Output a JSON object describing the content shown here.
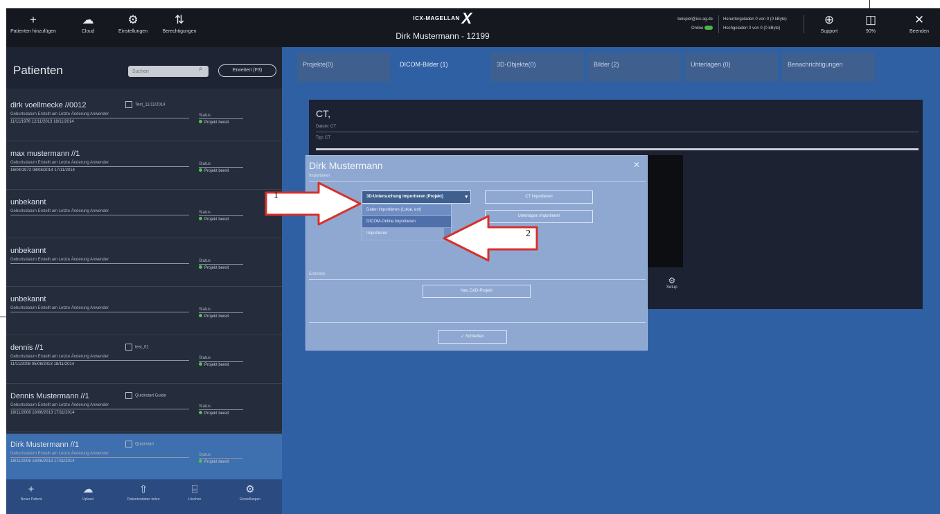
{
  "toolbar": {
    "items": [
      {
        "label": "Patienten hinzufügen",
        "icon": "plus-icon",
        "glyph": "+"
      },
      {
        "label": "Cloud",
        "icon": "cloud-icon",
        "glyph": "☁"
      },
      {
        "label": "Einstellungen",
        "icon": "gear-icon",
        "glyph": "⚙"
      },
      {
        "label": "Berechtigungen",
        "icon": "sort-icon",
        "glyph": "⇅"
      }
    ],
    "right_items": [
      {
        "label": "Support",
        "icon": "globe-icon",
        "glyph": "⊕"
      },
      {
        "label": "90%",
        "icon": "book-icon",
        "glyph": "◫"
      },
      {
        "label": "Beenden",
        "icon": "close-icon",
        "glyph": "✕"
      }
    ]
  },
  "app": {
    "logo_text": "ICX-MAGELLAN",
    "logo_mark": "X",
    "patient_title": "Dirk Mustermann - 12199"
  },
  "account": {
    "email": "beispiel@icx-ag.de",
    "status": "Online"
  },
  "storage": {
    "line1": "Heruntergeladen 0 von 0 (0 kByte)",
    "line2": "Hochgeladen 0 von 0 (0 kByte)"
  },
  "sidebar": {
    "title": "Patienten",
    "search_placeholder": "Suchen",
    "advanced_search": "Erweitert (F3)",
    "column_header": "Geburtsdatum  Erstellt am  Letzte Änderung  Anwender",
    "status_header": "Status",
    "patients": [
      {
        "name": "dirk voellmecke //0012",
        "note": "Test_11/11/2014",
        "vals": "11/11/1976   12/11/2013   18/11/2014",
        "status": "Projekt bereit"
      },
      {
        "name": "max mustermann //1",
        "note": "",
        "vals": "16/04/1972   08/08/2014   17/11/2014",
        "status": "Projekt bereit"
      },
      {
        "name": "unbekannt",
        "note": "",
        "vals": "",
        "status": "Projekt bereit"
      },
      {
        "name": "unbekannt",
        "note": "",
        "vals": "",
        "status": "Projekt bereit"
      },
      {
        "name": "unbekannt",
        "note": "",
        "vals": "",
        "status": "Projekt bereit"
      },
      {
        "name": "dennis //1",
        "note": "test_01",
        "vals": "11/11/2008   05/08/2013   18/11/2014",
        "status": "Projekt bereit"
      },
      {
        "name": "Dennis Mustermann //1",
        "note": "Quickstart Guide",
        "vals": "18/11/2008   18/06/2013   17/11/2014",
        "status": "Projekt bereit"
      },
      {
        "name": "Dirk Mustermann //1",
        "note": "Quickstart",
        "vals": "18/11/2008   18/06/2013   17/11/2014",
        "status": "Projekt bereit"
      }
    ],
    "footer": [
      {
        "label": "Neuer Patient",
        "icon": "plus-icon",
        "glyph": "+"
      },
      {
        "label": "Upload",
        "icon": "cloud-icon",
        "glyph": "☁"
      },
      {
        "label": "Patientendaten teilen",
        "icon": "upload-icon",
        "glyph": "⇧"
      },
      {
        "label": "Löschen",
        "icon": "trash-icon",
        "glyph": "⌸"
      },
      {
        "label": "Einstellungen",
        "icon": "gear-icon",
        "glyph": "⚙"
      }
    ]
  },
  "tabs": [
    {
      "label": "Projekte(0)"
    },
    {
      "label": "DICOM-Bilder (1)"
    },
    {
      "label": "3D-Objekte(0)"
    },
    {
      "label": "Bilder (2)"
    },
    {
      "label": "Unterlagen (0)"
    },
    {
      "label": "Benachrichtigungen"
    }
  ],
  "content": {
    "title": "CT,",
    "sub1": "Datum: CT",
    "sub2": "Typ: CT",
    "setup_label": "Setup"
  },
  "dialog": {
    "title": "Dirk Mustermann",
    "section1": "Importieren",
    "select_value": "3D-Untersuchung importieren (Projekt)",
    "dropdown": [
      "Daten importieren (Lokal, ext)",
      "DICOM-Online importieren",
      "Importieren"
    ],
    "btn_ct": "CT importieren",
    "btn_docs": "Unterlagen importieren",
    "section2": "Erstellen",
    "btn_create": "Neu CAD-Projekt",
    "btn_close": "✓  Schließen"
  },
  "callouts": [
    "1",
    "2"
  ],
  "colors": {
    "background": "#2f60a3",
    "topbar": "#15181f",
    "sidebar": "#252c3b",
    "dialog": "#8ea8d2",
    "status_green": "#4fc24f"
  }
}
